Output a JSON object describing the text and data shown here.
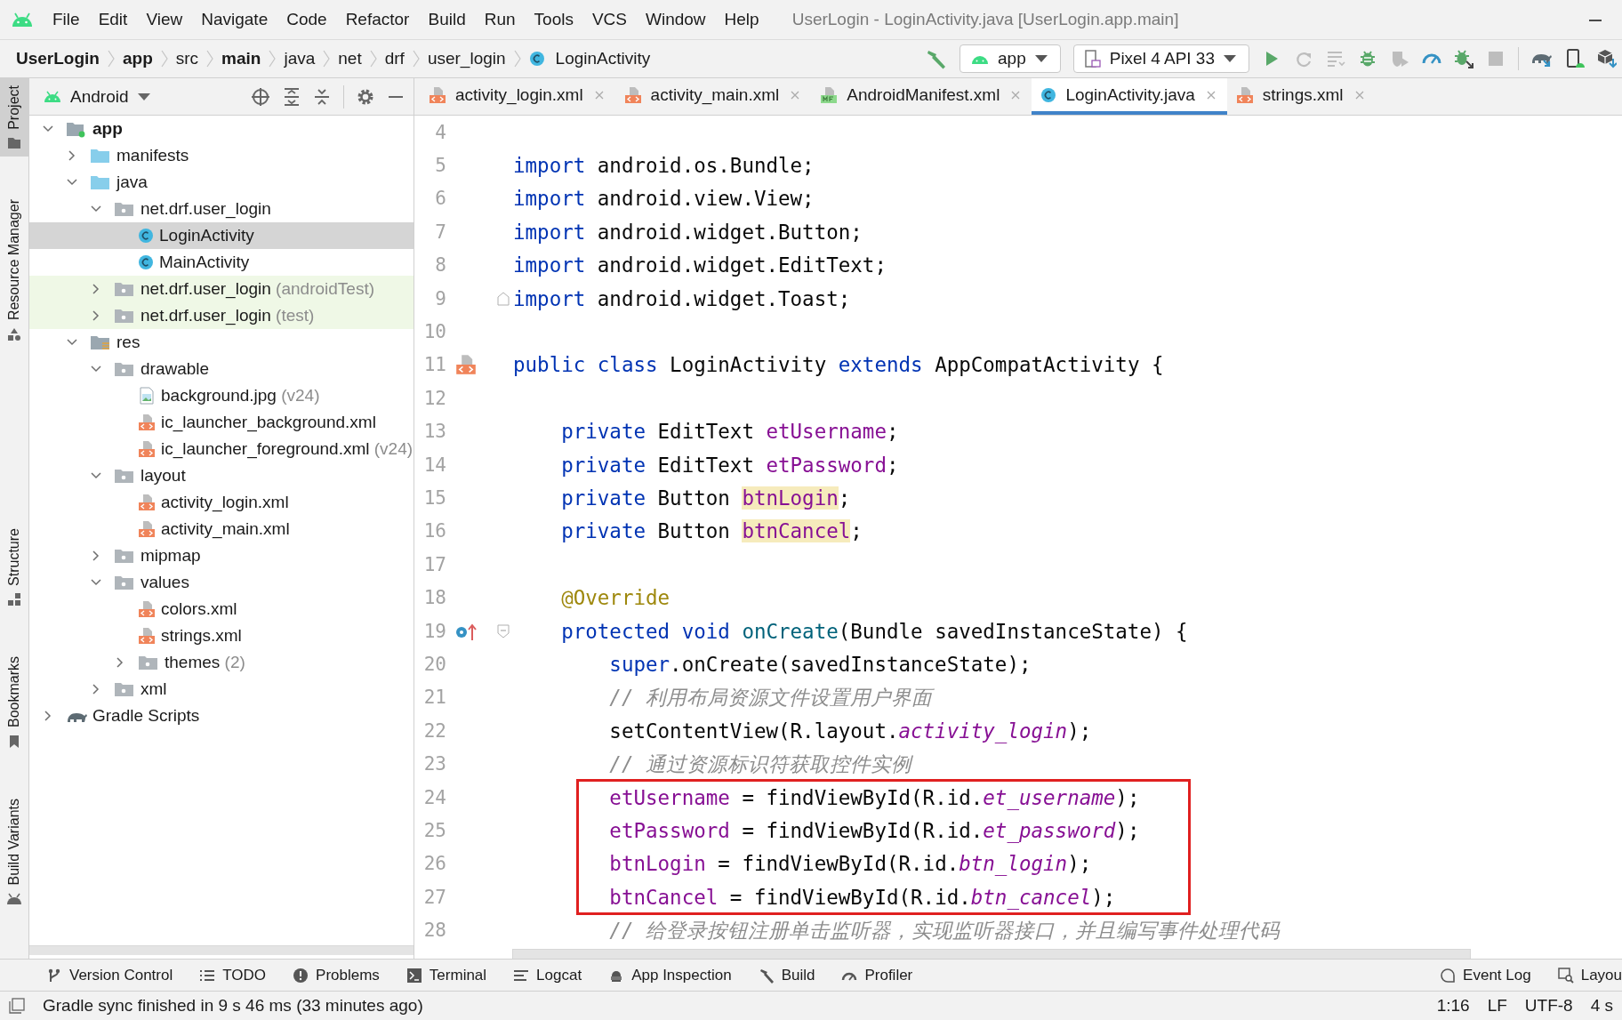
{
  "window": {
    "title": "UserLogin - LoginActivity.java [UserLogin.app.main]"
  },
  "menu": [
    "File",
    "Edit",
    "View",
    "Navigate",
    "Code",
    "Refactor",
    "Build",
    "Run",
    "Tools",
    "VCS",
    "Window",
    "Help"
  ],
  "breadcrumbs": [
    {
      "label": "UserLogin",
      "bold": true,
      "kind": "plain"
    },
    {
      "label": "app",
      "bold": true,
      "kind": "plain"
    },
    {
      "label": "src",
      "bold": false,
      "kind": "plain"
    },
    {
      "label": "main",
      "bold": true,
      "kind": "plain"
    },
    {
      "label": "java",
      "bold": false,
      "kind": "plain"
    },
    {
      "label": "net",
      "bold": false,
      "kind": "plain"
    },
    {
      "label": "drf",
      "bold": false,
      "kind": "plain"
    },
    {
      "label": "user_login",
      "bold": false,
      "kind": "plain"
    },
    {
      "label": "LoginActivity",
      "bold": false,
      "kind": "class"
    }
  ],
  "run_config": {
    "label": "app"
  },
  "device": {
    "label": "Pixel 4 API 33"
  },
  "toolbar_actions": [
    {
      "kind": "run",
      "disabled": false
    },
    {
      "kind": "rerun",
      "disabled": true
    },
    {
      "kind": "apply",
      "disabled": true
    },
    {
      "kind": "debug",
      "disabled": false
    },
    {
      "kind": "coverage",
      "disabled": true
    },
    {
      "kind": "profile",
      "disabled": false
    },
    {
      "kind": "attach",
      "disabled": false
    },
    {
      "kind": "stop",
      "disabled": true
    },
    {
      "kind": "sync",
      "disabled": false
    },
    {
      "kind": "device-manager",
      "disabled": false
    },
    {
      "kind": "sdk",
      "disabled": false
    }
  ],
  "tool_strip": {
    "top": [
      {
        "label": "Project",
        "selected": true
      },
      {
        "label": "Resource Manager",
        "selected": false
      }
    ],
    "bottom": [
      {
        "label": "Structure",
        "selected": false
      },
      {
        "label": "Bookmarks",
        "selected": false
      },
      {
        "label": "Build Variants",
        "selected": false
      }
    ]
  },
  "project_panel": {
    "view": "Android",
    "tree": [
      {
        "label": "app",
        "kind": "module",
        "bold": true,
        "expanded": true,
        "selected": false,
        "test_scope": false,
        "children": [
          {
            "label": "manifests",
            "kind": "source-folder",
            "expanded": false,
            "selected": false,
            "test_scope": false
          },
          {
            "label": "java",
            "kind": "source-folder",
            "expanded": true,
            "selected": false,
            "test_scope": false,
            "children": [
              {
                "label": "net.drf.user_login",
                "kind": "package",
                "expanded": true,
                "selected": false,
                "test_scope": false,
                "children": [
                  {
                    "label": "LoginActivity",
                    "kind": "class",
                    "selected": true,
                    "test_scope": false
                  },
                  {
                    "label": "MainActivity",
                    "kind": "class",
                    "selected": false,
                    "test_scope": false
                  }
                ]
              },
              {
                "label": "net.drf.user_login",
                "suffix": "(androidTest)",
                "kind": "package",
                "expanded": false,
                "selected": false,
                "test_scope": true
              },
              {
                "label": "net.drf.user_login",
                "suffix": "(test)",
                "kind": "package",
                "expanded": false,
                "selected": false,
                "test_scope": true
              }
            ]
          },
          {
            "label": "res",
            "kind": "res-folder",
            "expanded": true,
            "selected": false,
            "test_scope": false,
            "children": [
              {
                "label": "drawable",
                "kind": "package",
                "expanded": true,
                "selected": false,
                "test_scope": false,
                "children": [
                  {
                    "label": "background.jpg",
                    "suffix": "(v24)",
                    "kind": "image",
                    "selected": false,
                    "test_scope": false
                  },
                  {
                    "label": "ic_launcher_background.xml",
                    "kind": "xml",
                    "selected": false,
                    "test_scope": false
                  },
                  {
                    "label": "ic_launcher_foreground.xml",
                    "suffix": "(v24)",
                    "kind": "xml",
                    "selected": false,
                    "test_scope": false
                  }
                ]
              },
              {
                "label": "layout",
                "kind": "package",
                "expanded": true,
                "selected": false,
                "test_scope": false,
                "children": [
                  {
                    "label": "activity_login.xml",
                    "kind": "xml",
                    "selected": false,
                    "test_scope": false
                  },
                  {
                    "label": "activity_main.xml",
                    "kind": "xml",
                    "selected": false,
                    "test_scope": false
                  }
                ]
              },
              {
                "label": "mipmap",
                "kind": "package",
                "expanded": false,
                "selected": false,
                "test_scope": false
              },
              {
                "label": "values",
                "kind": "package",
                "expanded": true,
                "selected": false,
                "test_scope": false,
                "children": [
                  {
                    "label": "colors.xml",
                    "kind": "xml",
                    "selected": false,
                    "test_scope": false
                  },
                  {
                    "label": "strings.xml",
                    "kind": "xml",
                    "selected": false,
                    "test_scope": false
                  },
                  {
                    "label": "themes",
                    "suffix": "(2)",
                    "kind": "package",
                    "expanded": false,
                    "selected": false,
                    "test_scope": false
                  }
                ]
              },
              {
                "label": "xml",
                "kind": "package",
                "expanded": false,
                "selected": false,
                "test_scope": false
              }
            ]
          }
        ]
      },
      {
        "label": "Gradle Scripts",
        "kind": "gradle",
        "expanded": false,
        "selected": false,
        "test_scope": false
      }
    ]
  },
  "editor_tabs": [
    {
      "label": "activity_login.xml",
      "kind": "xml",
      "selected": false
    },
    {
      "label": "activity_main.xml",
      "kind": "xml",
      "selected": false
    },
    {
      "label": "AndroidManifest.xml",
      "kind": "manifest",
      "selected": false
    },
    {
      "label": "LoginActivity.java",
      "kind": "class",
      "selected": true
    },
    {
      "label": "strings.xml",
      "kind": "xml",
      "selected": false
    }
  ],
  "code": {
    "lines": [
      {
        "number": "4",
        "kind": "blank"
      },
      {
        "number": "5",
        "kind": "code",
        "tokens": [
          {
            "kind": "keyword",
            "text": "import"
          },
          {
            "kind": "plain",
            "text": " android.os.Bundle;"
          }
        ]
      },
      {
        "number": "6",
        "kind": "code",
        "tokens": [
          {
            "kind": "keyword",
            "text": "import"
          },
          {
            "kind": "plain",
            "text": " android.view.View;"
          }
        ]
      },
      {
        "number": "7",
        "kind": "code",
        "tokens": [
          {
            "kind": "keyword",
            "text": "import"
          },
          {
            "kind": "plain",
            "text": " android.widget.Button;"
          }
        ]
      },
      {
        "number": "8",
        "kind": "code",
        "tokens": [
          {
            "kind": "keyword",
            "text": "import"
          },
          {
            "kind": "plain",
            "text": " android.widget.EditText;"
          }
        ]
      },
      {
        "number": "9",
        "kind": "fold-end",
        "tokens": [
          {
            "kind": "keyword",
            "text": "import"
          },
          {
            "kind": "plain",
            "text": " android.widget.Toast;"
          }
        ]
      },
      {
        "number": "10",
        "kind": "blank"
      },
      {
        "number": "11",
        "kind": "class-start",
        "tokens": [
          {
            "kind": "keyword",
            "text": "public class"
          },
          {
            "kind": "plain",
            "text": " LoginActivity "
          },
          {
            "kind": "keyword",
            "text": "extends"
          },
          {
            "kind": "plain",
            "text": " AppCompatActivity {"
          }
        ]
      },
      {
        "number": "12",
        "kind": "blank"
      },
      {
        "number": "13",
        "kind": "code",
        "tokens": [
          {
            "kind": "keyword",
            "text": "    private"
          },
          {
            "kind": "plain",
            "text": " EditText "
          },
          {
            "kind": "field",
            "text": "etUsername"
          },
          {
            "kind": "plain",
            "text": ";"
          }
        ]
      },
      {
        "number": "14",
        "kind": "code",
        "tokens": [
          {
            "kind": "keyword",
            "text": "    private"
          },
          {
            "kind": "plain",
            "text": " EditText "
          },
          {
            "kind": "field",
            "text": "etPassword"
          },
          {
            "kind": "plain",
            "text": ";"
          }
        ]
      },
      {
        "number": "15",
        "kind": "code",
        "tokens": [
          {
            "kind": "keyword",
            "text": "    private"
          },
          {
            "kind": "plain",
            "text": " Button "
          },
          {
            "kind": "field_warning",
            "text": "btnLogin"
          },
          {
            "kind": "plain",
            "text": ";"
          }
        ]
      },
      {
        "number": "16",
        "kind": "code",
        "tokens": [
          {
            "kind": "keyword",
            "text": "    private"
          },
          {
            "kind": "plain",
            "text": " Button "
          },
          {
            "kind": "field_warning",
            "text": "btnCancel"
          },
          {
            "kind": "plain",
            "text": ";"
          }
        ]
      },
      {
        "number": "17",
        "kind": "blank"
      },
      {
        "number": "18",
        "kind": "code",
        "tokens": [
          {
            "kind": "annotation",
            "text": "    @Override"
          }
        ]
      },
      {
        "number": "19",
        "kind": "method-start",
        "tokens": [
          {
            "kind": "keyword",
            "text": "    protected void"
          },
          {
            "kind": "method",
            "text": " onCreate"
          },
          {
            "kind": "plain",
            "text": "(Bundle savedInstanceState) {"
          }
        ]
      },
      {
        "number": "20",
        "kind": "code",
        "tokens": [
          {
            "kind": "keyword",
            "text": "        super"
          },
          {
            "kind": "plain",
            "text": ".onCreate(savedInstanceState);"
          }
        ]
      },
      {
        "number": "21",
        "kind": "code",
        "tokens": [
          {
            "kind": "comment",
            "text": "        // 利用布局资源文件设置用户界面"
          }
        ]
      },
      {
        "number": "22",
        "kind": "code",
        "tokens": [
          {
            "kind": "plain",
            "text": "        setContentView(R.layout."
          },
          {
            "kind": "static",
            "text": "activity_login"
          },
          {
            "kind": "plain",
            "text": ");"
          }
        ]
      },
      {
        "number": "23",
        "kind": "code",
        "tokens": [
          {
            "kind": "comment",
            "text": "        // 通过资源标识符获取控件实例"
          }
        ]
      },
      {
        "number": "24",
        "kind": "code",
        "boxed": true,
        "tokens": [
          {
            "kind": "field",
            "text": "        etUsername"
          },
          {
            "kind": "plain",
            "text": " = findViewById(R.id."
          },
          {
            "kind": "static",
            "text": "et_username"
          },
          {
            "kind": "plain",
            "text": ");"
          }
        ]
      },
      {
        "number": "25",
        "kind": "code",
        "boxed": true,
        "tokens": [
          {
            "kind": "field",
            "text": "        etPassword"
          },
          {
            "kind": "plain",
            "text": " = findViewById(R.id."
          },
          {
            "kind": "static",
            "text": "et_password"
          },
          {
            "kind": "plain",
            "text": ");"
          }
        ]
      },
      {
        "number": "26",
        "kind": "code",
        "boxed": true,
        "tokens": [
          {
            "kind": "field",
            "text": "        btnLogin"
          },
          {
            "kind": "plain",
            "text": " = findViewById(R.id."
          },
          {
            "kind": "static",
            "text": "btn_login"
          },
          {
            "kind": "plain",
            "text": ");"
          }
        ]
      },
      {
        "number": "27",
        "kind": "code",
        "boxed": true,
        "tokens": [
          {
            "kind": "field",
            "text": "        btnCancel"
          },
          {
            "kind": "plain",
            "text": " = findViewById(R.id."
          },
          {
            "kind": "static",
            "text": "btn_cancel"
          },
          {
            "kind": "plain",
            "text": ");"
          }
        ]
      },
      {
        "number": "28",
        "kind": "code",
        "tokens": [
          {
            "kind": "comment",
            "text": "        // 给登录按钮注册单击监听器，实现监听器接口，并且编写事件处理代码"
          }
        ]
      }
    ]
  },
  "bottom_tools": {
    "left": [
      {
        "label": "Version Control",
        "kind": "vcs"
      },
      {
        "label": "TODO",
        "kind": "todo"
      },
      {
        "label": "Problems",
        "kind": "problems"
      },
      {
        "label": "Terminal",
        "kind": "terminal"
      },
      {
        "label": "Logcat",
        "kind": "logcat"
      },
      {
        "label": "App Inspection",
        "kind": "inspection"
      },
      {
        "label": "Build",
        "kind": "build"
      },
      {
        "label": "Profiler",
        "kind": "profiler"
      }
    ],
    "right": [
      {
        "label": "Event Log",
        "kind": "event-log"
      },
      {
        "label": "Layou",
        "kind": "layout-inspector"
      }
    ]
  },
  "status_bar": {
    "message": "Gradle sync finished in 9 s 46 ms (33 minutes ago)",
    "items": [
      "1:16",
      "LF",
      "UTF-8",
      "4 s"
    ]
  }
}
